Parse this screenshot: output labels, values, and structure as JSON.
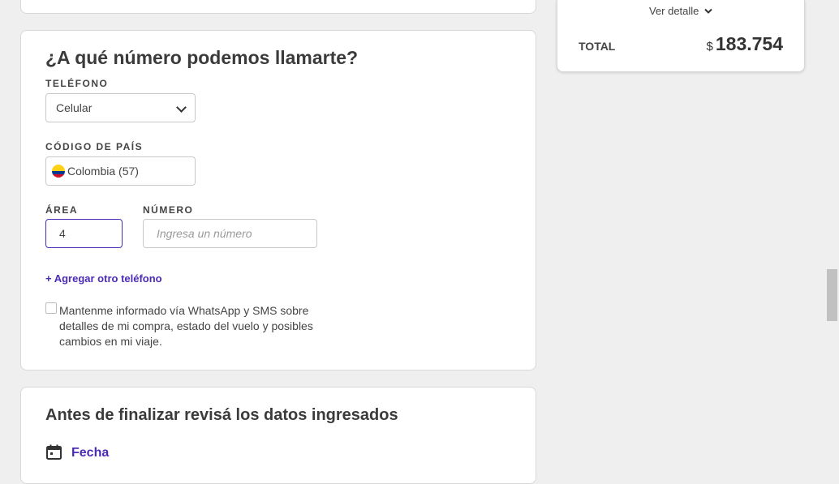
{
  "phone_section": {
    "title": "¿A qué número podemos llamarte?",
    "phone_label": "TELÉFONO",
    "phone_type_value": "Celular",
    "country_label": "CÓDIGO DE PAÍS",
    "country_value": "Colombia (57)",
    "area_label": "ÁREA",
    "area_value": "4",
    "number_label": "NÚMERO",
    "number_placeholder": "Ingresa un número",
    "add_phone_link": "+ Agregar otro teléfono",
    "whatsapp_text": "Mantenme informado vía WhatsApp y SMS sobre detalles de mi compra, estado del vuelo y posibles cambios en mi viaje."
  },
  "review_section": {
    "title": "Antes de finalizar revisá los datos ingresados",
    "date_label": "Fecha"
  },
  "summary": {
    "details_link": "Ver detalle",
    "total_label": "TOTAL",
    "currency": "$",
    "total_value": "183.754"
  },
  "colors": {
    "accent": "#4b2bb8",
    "background": "#efefef"
  }
}
